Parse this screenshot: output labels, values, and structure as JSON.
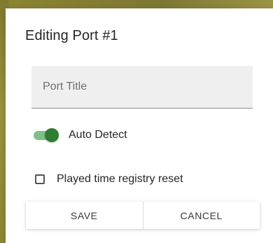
{
  "dialog": {
    "title": "Editing Port #1"
  },
  "port_title_field": {
    "placeholder": "Port Title",
    "value": ""
  },
  "auto_detect_toggle": {
    "label": "Auto Detect",
    "checked": true
  },
  "played_time_reset_checkbox": {
    "label": "Played time registry reset",
    "checked": false
  },
  "actions": {
    "save_label": "SAVE",
    "cancel_label": "CANCEL"
  },
  "colors": {
    "accent_green": "#2e7d32",
    "track_green": "#7fbf88",
    "field_bg": "#efefef"
  }
}
